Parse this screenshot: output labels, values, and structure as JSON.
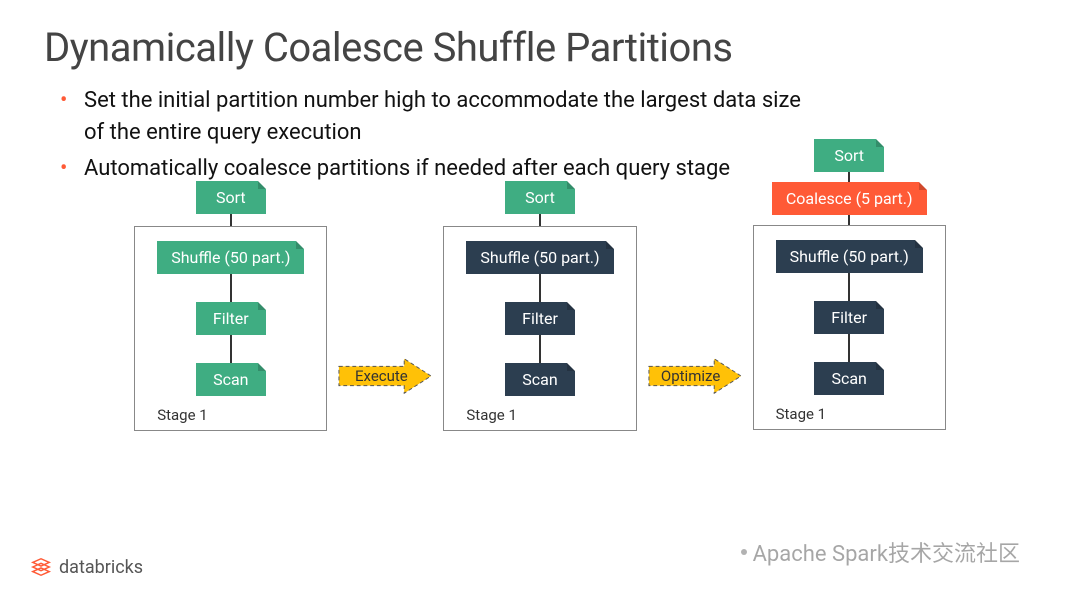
{
  "title": "Dynamically Coalesce Shuffle Partitions",
  "bullets": [
    "Set the initial partition number high to accommodate the largest data size of the entire query execution",
    "Automatically coalesce partitions if needed after each query stage"
  ],
  "plans": {
    "left": {
      "top_node": "Sort",
      "stage_nodes": [
        "Shuffle (50 part.)",
        "Filter",
        "Scan"
      ],
      "stage_label": "Stage 1",
      "color_scheme": "green"
    },
    "middle": {
      "top_node": "Sort",
      "stage_nodes": [
        "Shuffle (50 part.)",
        "Filter",
        "Scan"
      ],
      "stage_label": "Stage 1",
      "color_scheme": "dark"
    },
    "right": {
      "top_node": "Sort",
      "coalesce_node": "Coalesce (5 part.)",
      "stage_nodes": [
        "Shuffle (50 part.)",
        "Filter",
        "Scan"
      ],
      "stage_label": "Stage 1",
      "color_scheme": "dark"
    }
  },
  "arrows": {
    "execute": "Execute",
    "optimize": "Optimize"
  },
  "footer": {
    "brand": "databricks"
  },
  "watermark": "Apache Spark技术交流社区"
}
